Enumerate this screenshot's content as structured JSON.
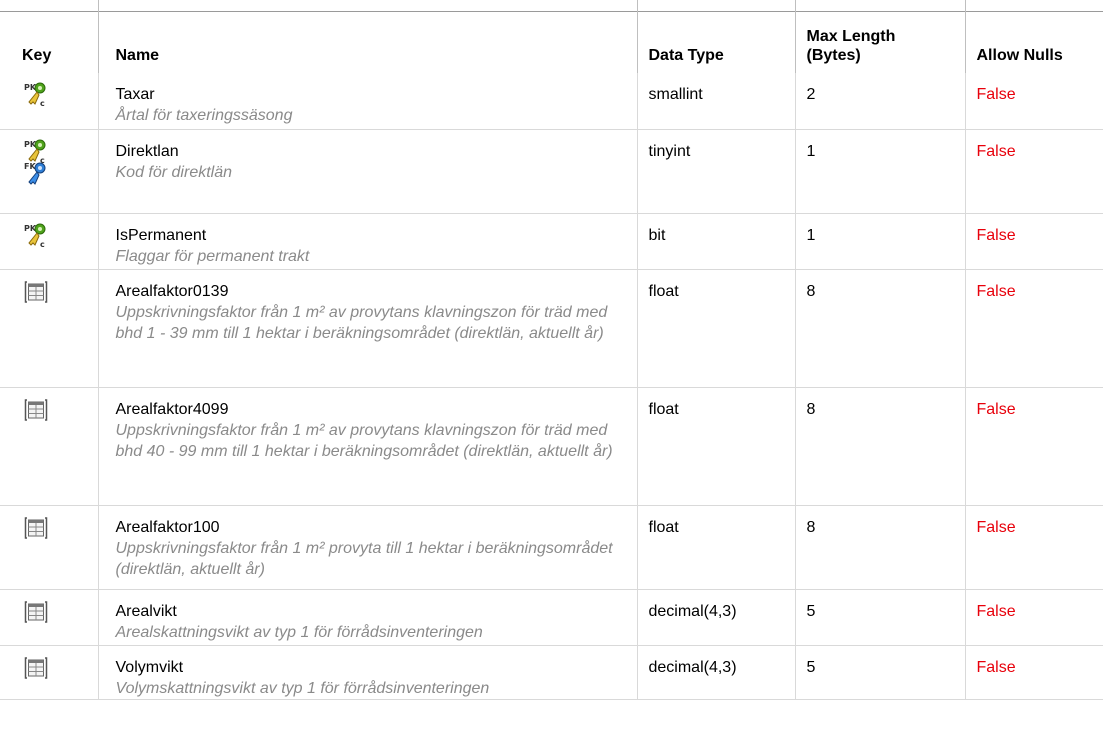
{
  "headers": {
    "key": "Key",
    "name": "Name",
    "data_type": "Data Type",
    "max_length_1": "Max Length",
    "max_length_2": "(Bytes)",
    "allow_nulls": "Allow Nulls"
  },
  "rows": [
    {
      "icons": [
        "pk-c-icon"
      ],
      "name": "Taxar",
      "desc": "Årtal för taxeringssäsong",
      "type": "smallint",
      "len": "2",
      "nulls": "False"
    },
    {
      "icons": [
        "pk-c-icon",
        "fk-icon"
      ],
      "name": "Direktlan",
      "desc": "Kod för direktlän",
      "type": "tinyint",
      "len": "1",
      "nulls": "False"
    },
    {
      "icons": [
        "pk-c-icon"
      ],
      "name": "IsPermanent",
      "desc": "Flaggar för permanent trakt",
      "type": "bit",
      "len": "1",
      "nulls": "False"
    },
    {
      "icons": [
        "column-icon"
      ],
      "name": "Arealfaktor0139",
      "desc": "Uppskrivningsfaktor från 1 m² av provytans klavningszon för träd med bhd 1 - 39 mm till 1 hektar i beräkningsområdet (direktlän, aktuellt år)",
      "type": "float",
      "len": "8",
      "nulls": "False"
    },
    {
      "icons": [
        "column-icon"
      ],
      "name": "Arealfaktor4099",
      "desc": "Uppskrivningsfaktor från 1 m² av provytans klavningszon för träd med bhd 40 - 99 mm till 1 hektar i beräkningsområdet (direktlän, aktuellt år)",
      "type": "float",
      "len": "8",
      "nulls": "False"
    },
    {
      "icons": [
        "column-icon"
      ],
      "name": "Arealfaktor100",
      "desc": "Uppskrivningsfaktor från 1 m² provyta till 1 hektar i beräkningsområdet (direktlän, aktuellt år)",
      "type": "float",
      "len": "8",
      "nulls": "False"
    },
    {
      "icons": [
        "column-icon"
      ],
      "name": "Arealvikt",
      "desc": "Arealskattningsvikt av typ 1 för förrådsinventeringen",
      "type": "decimal(4,3)",
      "len": "5",
      "nulls": "False"
    },
    {
      "icons": [
        "column-icon"
      ],
      "name": "Volymvikt",
      "desc": "Volymskattningsvikt av typ 1 för förrådsinventeringen",
      "type": "decimal(4,3)",
      "len": "5",
      "nulls": "False"
    }
  ]
}
